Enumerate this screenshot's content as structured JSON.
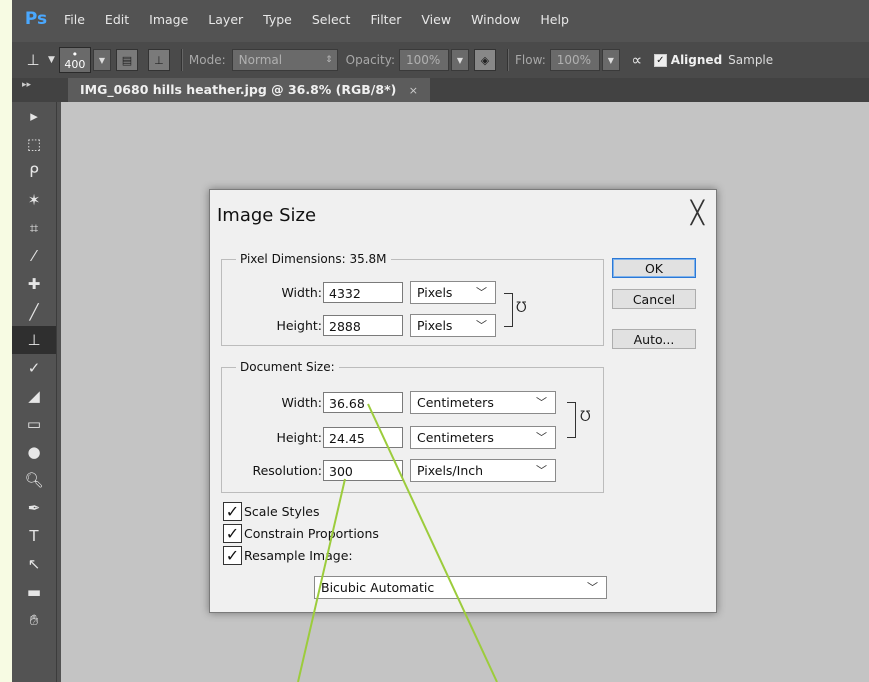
{
  "app": {
    "logo": "Ps"
  },
  "menu": [
    "File",
    "Edit",
    "Image",
    "Layer",
    "Type",
    "Select",
    "Filter",
    "View",
    "Window",
    "Help"
  ],
  "options_bar": {
    "brush_size": "400",
    "mode_label": "Mode:",
    "mode_value": "Normal",
    "opacity_label": "Opacity:",
    "opacity_value": "100%",
    "flow_label": "Flow:",
    "flow_value": "100%",
    "aligned_label": "Aligned",
    "sample_label": "Sample"
  },
  "document_tab": {
    "title": "IMG_0680 hills heather.jpg @ 36.8% (RGB/8*)",
    "close": "×"
  },
  "dialog": {
    "title": "Image Size",
    "close": "╳",
    "pixel_dimensions": {
      "legend": "Pixel Dimensions:  35.8M",
      "width_label": "Width:",
      "width_value": "4332",
      "width_unit": "Pixels",
      "height_label": "Height:",
      "height_value": "2888",
      "height_unit": "Pixels"
    },
    "document_size": {
      "legend": "Document Size:",
      "width_label": "Width:",
      "width_value": "36.68",
      "width_unit": "Centimeters",
      "height_label": "Height:",
      "height_value": "24.45",
      "height_unit": "Centimeters",
      "resolution_label": "Resolution:",
      "resolution_value": "300",
      "resolution_unit": "Pixels/Inch"
    },
    "buttons": {
      "ok": "OK",
      "cancel": "Cancel",
      "auto": "Auto..."
    },
    "options": {
      "scale_styles": "Scale Styles",
      "constrain": "Constrain Proportions",
      "resample": "Resample Image:",
      "method": "Bicubic Automatic"
    }
  },
  "colors": {
    "annotation_line": "#9ccc3c",
    "default_button_border": "#2b78d6"
  }
}
